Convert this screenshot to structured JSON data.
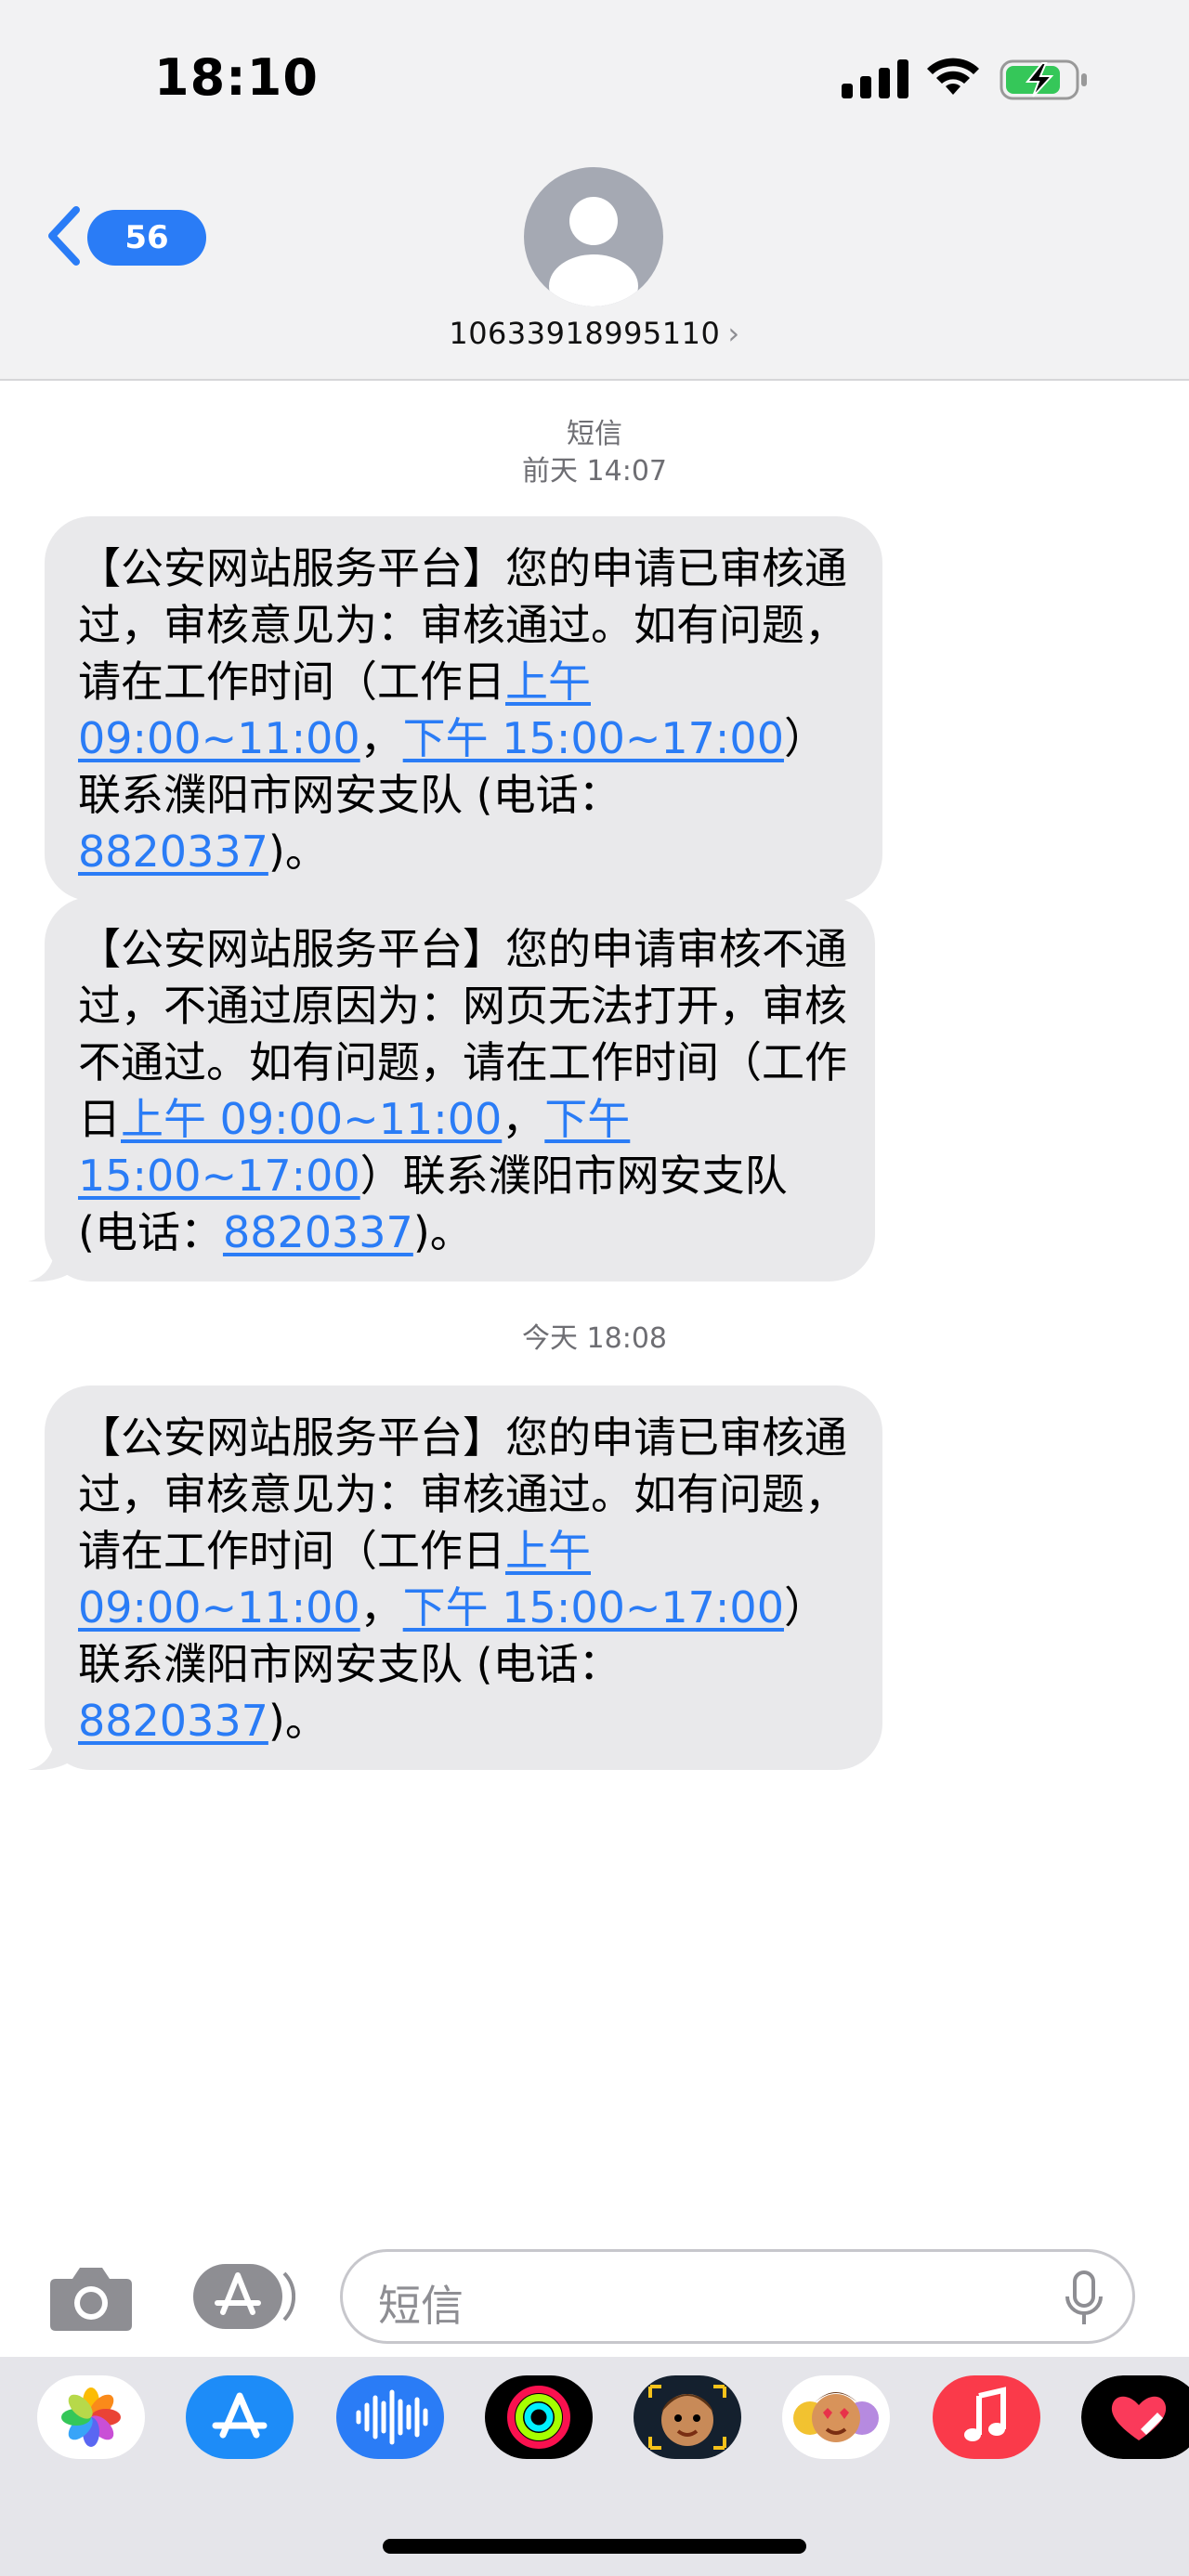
{
  "status_bar": {
    "time": "18:10"
  },
  "nav": {
    "back_count": "56",
    "contact_number": "10633918995110",
    "contact_chevron": "›"
  },
  "thread": {
    "header_label": "短信",
    "first_timestamp_day": "前天",
    "first_timestamp_time": "14:07",
    "second_timestamp_day": "今天",
    "second_timestamp_time": "18:08",
    "messages": [
      {
        "t1": "【公安网站服务平台】您的申请已审核通过，审核意见为：审核通过。如有问题，请在工作时间（工作日",
        "link1": "上午 09:00~11:00",
        "t2": "，",
        "link2": "下午 15:00~17:00",
        "t3": "）联系濮阳市网安支队 (电话：",
        "phone": "8820337",
        "t4": ")。"
      },
      {
        "t1": "【公安网站服务平台】您的申请审核不通过，不通过原因为：网页无法打开，审核不通过。如有问题，请在工作时间（工作日",
        "link1": "上午 09:00~11:00",
        "t2": "，",
        "link2": "下午 15:00~17:00",
        "t3": "）联系濮阳市网安支队 (电话：",
        "phone": "8820337",
        "t4": ")。"
      },
      {
        "t1": "【公安网站服务平台】您的申请已审核通过，审核意见为：审核通过。如有问题，请在工作时间（工作日",
        "link1": "上午 09:00~11:00",
        "t2": "，",
        "link2": "下午 15:00~17:00",
        "t3": "）联系濮阳市网安支队 (电话：",
        "phone": "8820337",
        "t4": ")。"
      }
    ]
  },
  "composer": {
    "placeholder": "短信"
  },
  "drawer_apps": [
    "photos-icon",
    "app-store-icon",
    "audio-message-icon",
    "activity-icon",
    "memoji-icon",
    "animoji-icon",
    "music-icon",
    "digital-touch-icon"
  ],
  "colors": {
    "accent": "#2a7cf6",
    "bubble": "#e9e9eb",
    "header": "#f2f2f3",
    "music": "#fa3a4a"
  }
}
